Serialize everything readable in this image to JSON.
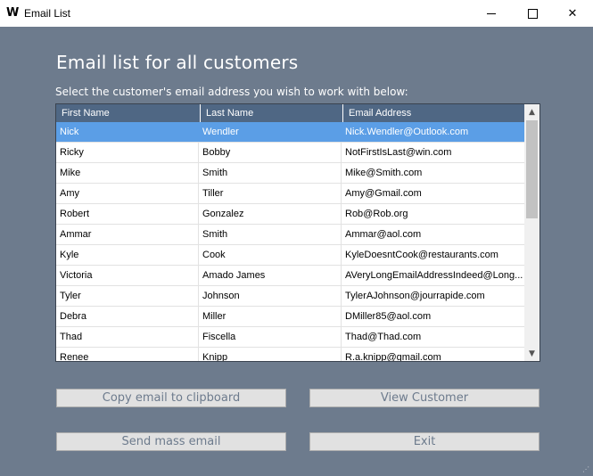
{
  "window": {
    "title": "Email List",
    "app_icon": "W"
  },
  "heading": "Email list for all customers",
  "instructions": "Select the customer's email address you wish to work with below:",
  "table": {
    "columns": [
      "First Name",
      "Last Name",
      "Email Address"
    ],
    "selected_row": 0,
    "rows": [
      [
        "Nick",
        "Wendler",
        "Nick.Wendler@Outlook.com"
      ],
      [
        "Ricky",
        "Bobby",
        "NotFirstIsLast@win.com"
      ],
      [
        "Mike",
        "Smith",
        "Mike@Smith.com"
      ],
      [
        "Amy",
        "Tiller",
        "Amy@Gmail.com"
      ],
      [
        "Robert",
        "Gonzalez",
        "Rob@Rob.org"
      ],
      [
        "Ammar",
        "Smith",
        "Ammar@aol.com"
      ],
      [
        "Kyle",
        "Cook",
        "KyleDoesntCook@restaurants.com"
      ],
      [
        "Victoria",
        "Amado James",
        "AVeryLongEmailAddressIndeed@Long..."
      ],
      [
        "Tyler",
        "Johnson",
        "TylerAJohnson@jourrapide.com"
      ],
      [
        "Debra",
        "Miller",
        "DMiller85@aol.com"
      ],
      [
        "Thad",
        "Fiscella",
        "Thad@Thad.com"
      ],
      [
        "Renee",
        "Knipp",
        "R.a.knipp@gmail.com"
      ],
      [
        "",
        "",
        ""
      ]
    ]
  },
  "buttons": {
    "copy": "Copy email to clipboard",
    "view": "View Customer",
    "mass": "Send mass email",
    "exit": "Exit"
  },
  "colors": {
    "background": "#6d7b8d",
    "header": "#4f6784",
    "selection": "#5b9ee6"
  }
}
